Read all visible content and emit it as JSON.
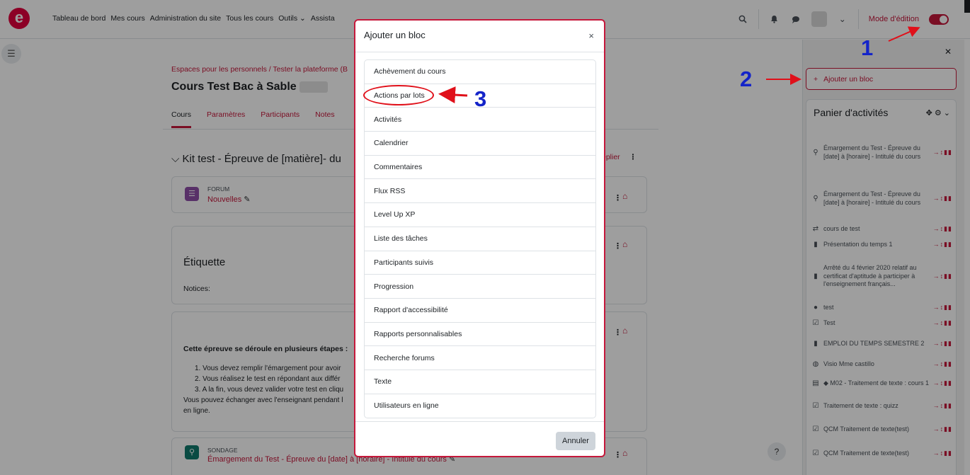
{
  "topnav": {
    "logo_letter": "e",
    "menu": [
      "Tableau de bord",
      "Mes cours",
      "Administration du site",
      "Tous les cours",
      "Outils ⌄",
      "Assista"
    ],
    "edit_mode_label": "Mode d'édition"
  },
  "course": {
    "breadcrumb": "Espaces pour les personnels  /  Tester la plateforme (B",
    "title": "Cours Test Bac à Sable",
    "tabs": [
      "Cours",
      "Paramètres",
      "Participants",
      "Notes"
    ],
    "section_title": "Kit test - Épreuve de [matière]- du",
    "replier": "eplier",
    "forum": {
      "type": "FORUM",
      "name": "Nouvelles"
    },
    "label": {
      "title": "Étiquette",
      "notices": "Notices:"
    },
    "etapes": {
      "title": "Cette épreuve se déroule en plusieurs étapes :",
      "items": [
        "1. Vous devez remplir l'émargement pour avoir",
        "2. Vous réalisez le test en répondant aux différ",
        "3. A la fin, vous devez valider votre test en cliqu"
      ],
      "footer_1": "Vous pouvez échanger avec l'enseignant pendant l",
      "footer_2": "en ligne."
    },
    "sondage": {
      "type": "SONDAGE",
      "name": "Émargement du Test - Épreuve du [date] à [horaire] - Intitulé du cours"
    }
  },
  "drawer": {
    "add_block": "Ajouter un bloc",
    "panier_title": "Panier d'activités",
    "items": [
      {
        "icon": "⚲",
        "icon_name": "feedback-icon",
        "text": "Émargement du Test - Épreuve du [date] à [horaire] - Intitulé du cours"
      },
      {
        "icon": "⚲",
        "icon_name": "feedback-icon",
        "text": "Émargement du Test - Épreuve du [date] à [horaire] - Intitulé du cours"
      },
      {
        "icon": "⇄",
        "icon_name": "lesson-icon",
        "text": "cours de test"
      },
      {
        "icon": "▮",
        "icon_name": "pdf-icon",
        "text": "Présentation du temps 1"
      },
      {
        "icon": "▮",
        "icon_name": "pdf-icon",
        "text": "Arrêté du 4 février 2020 relatif au certificat d'aptitude à participer à l'enseignement français..."
      },
      {
        "icon": "●",
        "icon_name": "bigbluebutton-icon",
        "text": "test"
      },
      {
        "icon": "☑",
        "icon_name": "quiz-icon",
        "text": "Test"
      },
      {
        "icon": "▮",
        "icon_name": "pdf-icon",
        "text": "EMPLOI DU TEMPS SEMESTRE 2"
      },
      {
        "icon": "◍",
        "icon_name": "url-icon",
        "text": "Visio Mme castillo"
      },
      {
        "icon": "▤",
        "icon_name": "page-icon",
        "text": "◆ M02 - Traitement de texte : cours 1"
      },
      {
        "icon": "☑",
        "icon_name": "quiz-icon",
        "text": "Traitement de texte : quizz"
      },
      {
        "icon": "☑",
        "icon_name": "quiz-icon",
        "text": "QCM Traitement de texte(test)"
      },
      {
        "icon": "☑",
        "icon_name": "quiz-icon",
        "text": "QCM Traitement de texte(test)"
      }
    ],
    "item_actions": "→↕▮▮"
  },
  "modal": {
    "title": "Ajouter un bloc",
    "close": "×",
    "blocks": [
      "Achèvement du cours",
      "Actions par lots",
      "Activités",
      "Calendrier",
      "Commentaires",
      "Flux RSS",
      "Level Up XP",
      "Liste des tâches",
      "Participants suivis",
      "Progression",
      "Rapport d'accessibilité",
      "Rapports personnalisables",
      "Recherche forums",
      "Texte",
      "Utilisateurs en ligne"
    ],
    "cancel": "Annuler"
  },
  "annotations": {
    "one": "1",
    "two": "2",
    "three": "3",
    "color_number": "#1424c9",
    "color_arrow": "#e0101a"
  },
  "help": "?",
  "colors": {
    "brand": "#c5183b",
    "logo": "#e3003e"
  }
}
